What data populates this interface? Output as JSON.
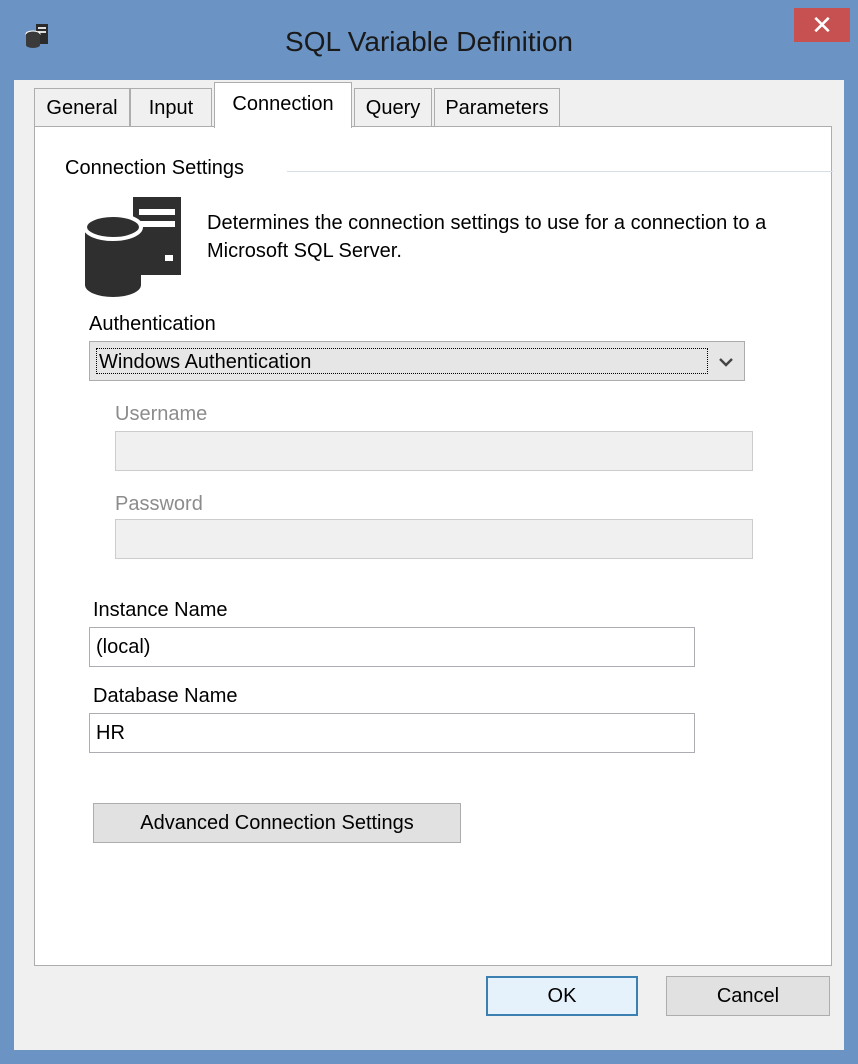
{
  "window": {
    "title": "SQL Variable Definition",
    "close_glyph": "✕",
    "icon": "database-server-icon"
  },
  "tabs": [
    {
      "label": "General",
      "active": false
    },
    {
      "label": "Input",
      "active": false
    },
    {
      "label": "Connection",
      "active": true
    },
    {
      "label": "Query",
      "active": false
    },
    {
      "label": "Parameters",
      "active": false
    }
  ],
  "connection": {
    "group_title": "Connection Settings",
    "description": "Determines the connection settings to use for a connection to a Microsoft SQL Server.",
    "authentication": {
      "label": "Authentication",
      "value": "Windows Authentication"
    },
    "username": {
      "label": "Username",
      "value": "",
      "enabled": false
    },
    "password": {
      "label": "Password",
      "value": "",
      "enabled": false
    },
    "instance": {
      "label": "Instance Name",
      "value": "(local)"
    },
    "database": {
      "label": "Database Name",
      "value": "HR"
    },
    "advanced_button": "Advanced Connection Settings"
  },
  "footer": {
    "ok_label": "OK",
    "cancel_label": "Cancel"
  },
  "colors": {
    "titlebar": "#6b93c4",
    "close": "#c75050",
    "default_button_border": "#3c7fb1"
  }
}
